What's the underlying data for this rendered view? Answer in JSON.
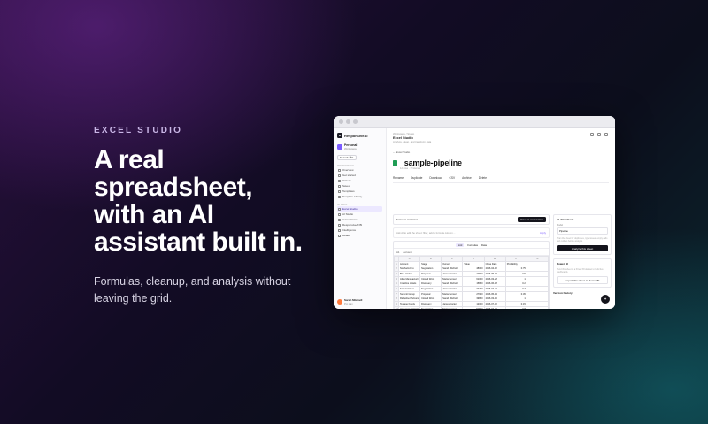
{
  "hero": {
    "eyebrow": "EXCEL STUDIO",
    "headline": [
      "A real",
      "spreadsheet,",
      "with an AI",
      "assistant built in."
    ],
    "subcopy": "Formulas, cleanup, and analysis without leaving the grid."
  },
  "app": {
    "brand": "ResponsiveAI",
    "workspace": {
      "name": "Personal",
      "sub": "Workspace"
    },
    "search_label": "Search ⌘K",
    "section_workspace": "WORKSPACE",
    "nav": [
      "Overview",
      "Get started",
      "History",
      "Saved",
      "Templates",
      "Template Library"
    ],
    "section_studio": "STUDIO",
    "studio_nav": [
      "Excel Studio",
      "AI Studio",
      "Automations",
      "ResponsiveAI BI",
      "Intelligence",
      "Reads"
    ],
    "user": {
      "name": "Sarah Mitchell",
      "plan": "Pro plan"
    },
    "breadcrumb": "Workspace / Studio",
    "page_title": "Excel Studio",
    "page_sub": "Analyze, clean, and transform data",
    "back": "← Excel Studio",
    "doc_title": "_sample-pipeline",
    "doc_meta": "12 rows · 7 columns",
    "actions": [
      "Rename",
      "Duplicate",
      "Download",
      "CSV",
      "Archive",
      "Delete"
    ],
    "assistant_label": "Formula assistant",
    "assistant_button": "Save as new version",
    "prompt_placeholder": "Ask AI to edit the sheet: filter, add a formula column…",
    "prompt_apply": "Apply",
    "sheet_tabs": [
      "Grid",
      "Formulas",
      "Data"
    ],
    "formula_cell": "A1",
    "formula_value": "Account",
    "columns": [
      "A",
      "B",
      "C",
      "D",
      "E",
      "F",
      "G"
    ],
    "rows": [
      [
        "Account",
        "Stage",
        "Owner",
        "Value",
        "Close Date",
        "Probability"
      ],
      [
        "Northwind Co",
        "Negotiation",
        "Sarah Mitchell",
        "48000",
        "2026-04-12",
        "0.75"
      ],
      [
        "Blue Harbor",
        "Proposal",
        "James Carter",
        "22500",
        "2026-05-03",
        "0.5"
      ],
      [
        "Atlas Manufacturing",
        "Closed Won",
        "Maria Gomez",
        "61000",
        "2026-03-28",
        "1"
      ],
      [
        "Crestline Hotels",
        "Discovery",
        "Sarah Mitchell",
        "15800",
        "2026-06-18",
        "0.2"
      ],
      [
        "Forward & Co",
        "Negotiation",
        "James Carter",
        "34200",
        "2026-04-22",
        "0.7"
      ],
      [
        "Summit Group",
        "Proposal",
        "Maria Gomez",
        "27900",
        "2026-05-14",
        "0.45"
      ],
      [
        "Ridgeline Partners",
        "Closed Won",
        "Sarah Mitchell",
        "39800",
        "2026-03-15",
        "1"
      ],
      [
        "Teslage Foods",
        "Discovery",
        "James Carter",
        "12000",
        "2026-07-02",
        "0.15"
      ],
      [
        "Harborview Hotels",
        "Negotiation",
        "Maria Gomez",
        "51500",
        "2026-04-30",
        "0.8"
      ],
      [
        "Cobalt Bakery",
        "Closed Lost",
        "Sarah Mitchell",
        "9400",
        "2026-03-09",
        "0"
      ],
      [
        "Meridian Fit",
        "Proposal",
        "James Carter",
        "31200",
        "2026-05-21",
        "0.45"
      ],
      [
        "Summit West",
        "Negotiation",
        "Maria Gomez",
        "44700",
        "2026-04-19",
        "0.7"
      ]
    ],
    "panel_data_check": {
      "title": "AI data check",
      "label": "Model",
      "select": "Pipeline",
      "note": "Scan the sheet for duplicates, type issues, empty cells and outliers before analysis.",
      "button": "Analyze this sheet"
    },
    "panel_power_bi": {
      "title": "Power BI",
      "note": "Send this sheet to a Power BI dataset to build live dashboards.",
      "button": "Export this sheet to Power BI"
    },
    "version_history": "Version history"
  }
}
